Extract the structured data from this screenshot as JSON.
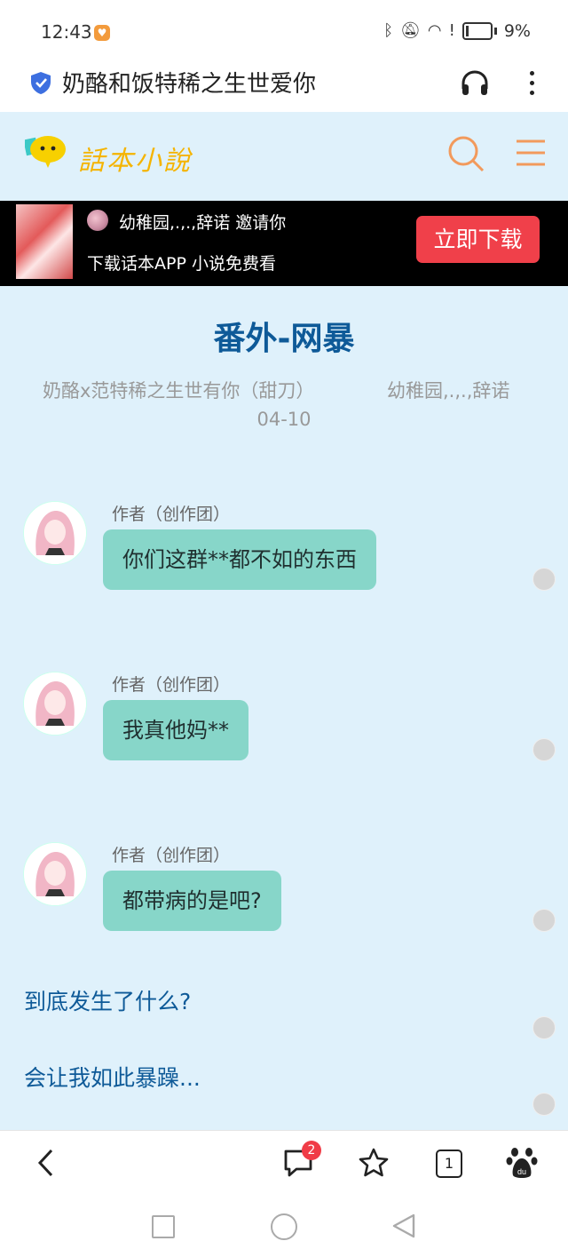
{
  "status": {
    "time": "12:43",
    "battery": "9%"
  },
  "browser": {
    "title": "奶酪和饭特稀之生世爱你"
  },
  "site": {
    "logo_text": "話本小說"
  },
  "banner": {
    "inviter": "幼稚园,.,.,辞诺 邀请你",
    "tagline": "下载话本APP 小说免费看",
    "download_label": "立即下载"
  },
  "chapter": {
    "title": "番外-网暴",
    "book": "奶酪x范特稀之生世有你（甜刀）",
    "author": "幼稚园,.,.,辞诺",
    "date": "04-10"
  },
  "messages": [
    {
      "name": "作者（创作团）",
      "text": "你们这群**都不如的东西"
    },
    {
      "name": "作者（创作团）",
      "text": "我真他妈**"
    },
    {
      "name": "作者（创作团）",
      "text": "都带病的是吧?"
    }
  ],
  "narration": [
    "到底发生了什么?",
    "会让我如此暴躁..."
  ],
  "toolbar": {
    "comments_badge": "2",
    "tabs_count": "1"
  },
  "colors": {
    "page_bg": "#dff1fb",
    "bubble": "#87d6c9",
    "accent": "#0e5a98",
    "download": "#f0404a",
    "icon_orange": "#f29a5c"
  }
}
